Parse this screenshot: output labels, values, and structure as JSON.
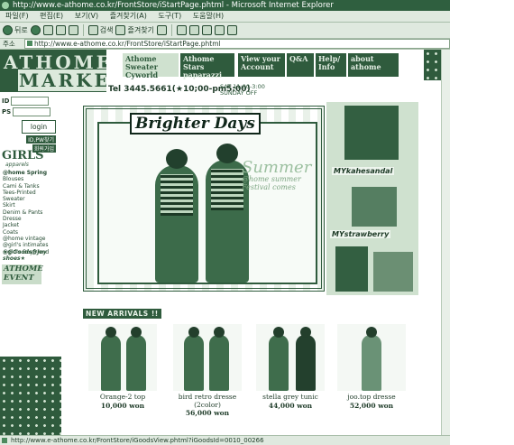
{
  "window": {
    "title": "http://www.e-athome.co.kr/FrontStore/iStartPage.phtml - Microsoft Internet Explorer"
  },
  "menu": [
    "파일(F)",
    "편집(E)",
    "보기(V)",
    "즐겨찾기(A)",
    "도구(T)",
    "도움말(H)"
  ],
  "toolbar": {
    "back": "뒤로",
    "search": "검색",
    "favorites": "즐겨찾기"
  },
  "address": {
    "label": "주소(D)",
    "url": "http://www.e-athome.co.kr/FrontStore/iStartPage.phtml"
  },
  "logo": {
    "line1": "ATHOME",
    "line2": "MARKET"
  },
  "header": {
    "sweater": "Athome Sweater Cyworld",
    "stars": "Athome Stars paparazzi",
    "account": "View your Account",
    "qa": "Q&A",
    "help": "Help/ Info",
    "about": "about athome",
    "phone": "Tel 3445.5661(★10;00-pm5;00)",
    "sat": "SAT 11:00-3:00",
    "sunday": "SUNDAY OFF"
  },
  "login": {
    "id_label": "ID",
    "pw_label": "PS",
    "button": "login",
    "find_id": "ID,PW찾기",
    "join": "회원가입"
  },
  "categories": {
    "title": "GIRLS",
    "subtitle": "apparels",
    "heading": "@home Spring",
    "items": [
      "Blouses",
      "Cami & Tanks",
      "Tees-Printed",
      "Sweater",
      "Skirt",
      "Denim & Pants",
      "Dresse",
      "Jacket",
      "Coats",
      "@home vintage",
      "@girl's intimates",
      "@girl's Boyfriend"
    ],
    "extra": [
      "★@Goods@Joy",
      "shoes★"
    ],
    "event": [
      "ATHOME",
      "EVENT"
    ]
  },
  "banner": {
    "title": "Brighter Days",
    "summer": "Summer",
    "summer_sub": "@home summer Festival comes",
    "tag1": "MYkahesandal",
    "tag2": "MYstrawberry"
  },
  "arrivals": {
    "title": "NEW ARRIVALS !!",
    "products": [
      {
        "name": "Orange-2 top",
        "price": "10,000 won"
      },
      {
        "name": "bird retro dresse (2color)",
        "price": "56,000 won"
      },
      {
        "name": "stella grey tunic",
        "price": "44,000 won"
      },
      {
        "name": "joo.top dresse",
        "price": "52,000 won"
      }
    ]
  },
  "status": {
    "text": "http://www.e-athome.co.kr/FrontStore/iGoodsView.phtml?iGoodsId=0010_00266"
  },
  "colors": {
    "theme": "#2f5b3d",
    "pale": "#dfe9df"
  }
}
